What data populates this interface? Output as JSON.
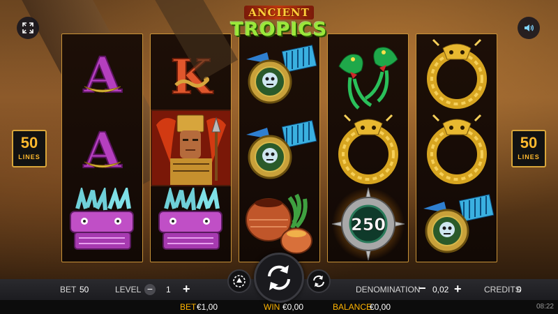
{
  "logo": {
    "line1": "ANCIENT",
    "line2": "TROPICS"
  },
  "lines_badge": {
    "value": "50",
    "label": "LINES"
  },
  "reels": [
    [
      "letter-a",
      "letter-a",
      "feathered-serpent"
    ],
    [
      "letter-k",
      "aztec-warrior",
      "feathered-serpent"
    ],
    [
      "jade-amulet",
      "jade-amulet",
      "clay-pots"
    ],
    [
      "quetzal-birds",
      "golden-dragon",
      "coin-250"
    ],
    [
      "golden-dragon",
      "golden-dragon",
      "jade-amulet"
    ]
  ],
  "symbols": {
    "letter_a": "A",
    "letter_k": "K",
    "coin_value": "250"
  },
  "controls": {
    "bet_label": "BET",
    "bet_value": "50",
    "level_label": "LEVEL",
    "level_value": "1",
    "denomination_label": "DENOMINATION",
    "denomination_value": "0,02",
    "credits_label": "CREDITS",
    "credits_value": "0",
    "minus": "−",
    "plus": "+"
  },
  "status": {
    "bet_label": "BET",
    "bet_value": "€1,00",
    "win_label": "WIN",
    "win_value": "€0,00",
    "balance_label": "BALANCE",
    "balance_value": "€0,00",
    "clock": "08:22"
  },
  "icons": {
    "fullscreen": "fullscreen-icon",
    "sound": "speaker-icon",
    "autoplay": "autoplay-icon",
    "spin": "spin-icon",
    "quickspin": "quick-spin-icon"
  },
  "colors": {
    "accent": "#ffb400",
    "reel_border": "#c99338",
    "badge_text": "#ffb92e",
    "logo_green": "#9be83a"
  }
}
